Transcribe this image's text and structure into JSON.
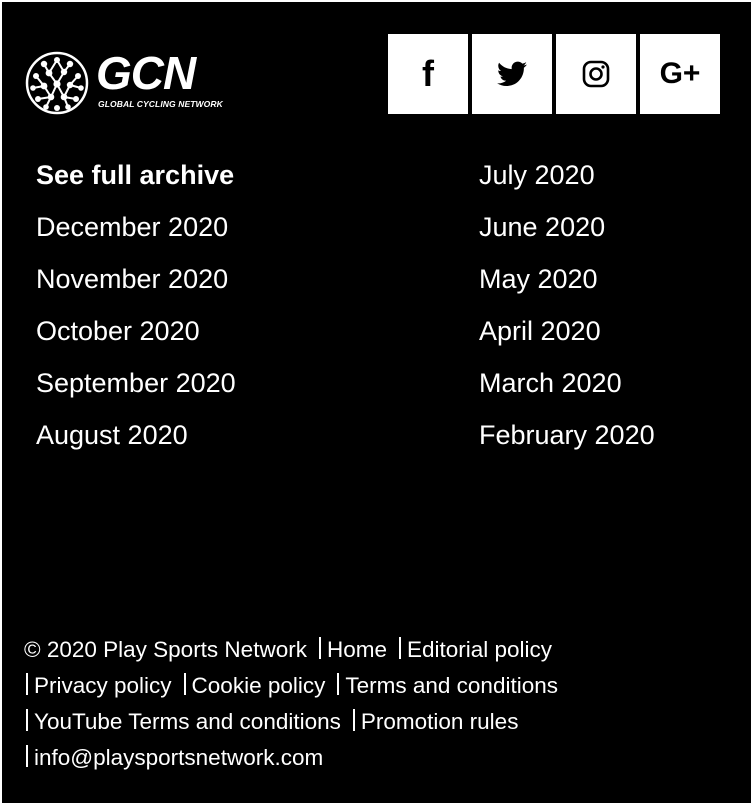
{
  "brand": {
    "name": "GCN",
    "tagline": "GLOBAL CYCLING NETWORK"
  },
  "social": [
    {
      "icon": "facebook-icon",
      "label": "f"
    },
    {
      "icon": "twitter-icon",
      "label": ""
    },
    {
      "icon": "instagram-icon",
      "label": ""
    },
    {
      "icon": "google-plus-icon",
      "label": "G+"
    }
  ],
  "archive": {
    "left": [
      "See full archive",
      "December 2020",
      "November 2020",
      "October 2020",
      "September 2020",
      "August 2020"
    ],
    "right": [
      "July 2020",
      "June 2020",
      "May 2020",
      "April 2020",
      "March 2020",
      "February 2020"
    ]
  },
  "footer": {
    "copyright": "© 2020 Play Sports Network",
    "home": "Home",
    "editorial": "Editorial policy",
    "privacy": "Privacy policy",
    "cookie": "Cookie policy",
    "terms": "Terms and conditions",
    "youtube_terms": "YouTube Terms and conditions",
    "promotion": "Promotion rules",
    "email": "info@playsportsnetwork.com"
  },
  "colors": {
    "background": "#000000",
    "text": "#ffffff",
    "social_tile": "#ffffff",
    "social_icon": "#000000"
  }
}
